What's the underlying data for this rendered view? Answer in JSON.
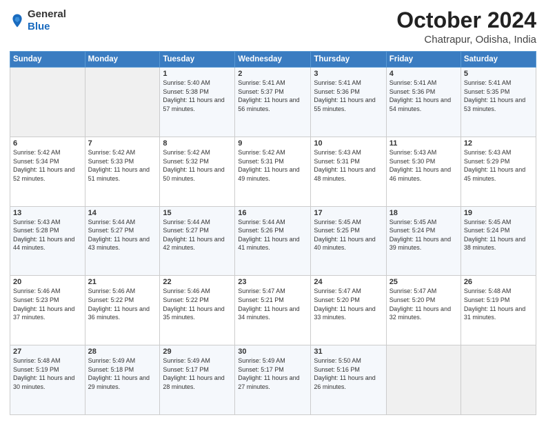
{
  "header": {
    "logo_general": "General",
    "logo_blue": "Blue",
    "month": "October 2024",
    "location": "Chatrapur, Odisha, India"
  },
  "days_of_week": [
    "Sunday",
    "Monday",
    "Tuesday",
    "Wednesday",
    "Thursday",
    "Friday",
    "Saturday"
  ],
  "weeks": [
    [
      {
        "day": "",
        "sunrise": "",
        "sunset": "",
        "daylight": ""
      },
      {
        "day": "",
        "sunrise": "",
        "sunset": "",
        "daylight": ""
      },
      {
        "day": "1",
        "sunrise": "Sunrise: 5:40 AM",
        "sunset": "Sunset: 5:38 PM",
        "daylight": "Daylight: 11 hours and 57 minutes."
      },
      {
        "day": "2",
        "sunrise": "Sunrise: 5:41 AM",
        "sunset": "Sunset: 5:37 PM",
        "daylight": "Daylight: 11 hours and 56 minutes."
      },
      {
        "day": "3",
        "sunrise": "Sunrise: 5:41 AM",
        "sunset": "Sunset: 5:36 PM",
        "daylight": "Daylight: 11 hours and 55 minutes."
      },
      {
        "day": "4",
        "sunrise": "Sunrise: 5:41 AM",
        "sunset": "Sunset: 5:36 PM",
        "daylight": "Daylight: 11 hours and 54 minutes."
      },
      {
        "day": "5",
        "sunrise": "Sunrise: 5:41 AM",
        "sunset": "Sunset: 5:35 PM",
        "daylight": "Daylight: 11 hours and 53 minutes."
      }
    ],
    [
      {
        "day": "6",
        "sunrise": "Sunrise: 5:42 AM",
        "sunset": "Sunset: 5:34 PM",
        "daylight": "Daylight: 11 hours and 52 minutes."
      },
      {
        "day": "7",
        "sunrise": "Sunrise: 5:42 AM",
        "sunset": "Sunset: 5:33 PM",
        "daylight": "Daylight: 11 hours and 51 minutes."
      },
      {
        "day": "8",
        "sunrise": "Sunrise: 5:42 AM",
        "sunset": "Sunset: 5:32 PM",
        "daylight": "Daylight: 11 hours and 50 minutes."
      },
      {
        "day": "9",
        "sunrise": "Sunrise: 5:42 AM",
        "sunset": "Sunset: 5:31 PM",
        "daylight": "Daylight: 11 hours and 49 minutes."
      },
      {
        "day": "10",
        "sunrise": "Sunrise: 5:43 AM",
        "sunset": "Sunset: 5:31 PM",
        "daylight": "Daylight: 11 hours and 48 minutes."
      },
      {
        "day": "11",
        "sunrise": "Sunrise: 5:43 AM",
        "sunset": "Sunset: 5:30 PM",
        "daylight": "Daylight: 11 hours and 46 minutes."
      },
      {
        "day": "12",
        "sunrise": "Sunrise: 5:43 AM",
        "sunset": "Sunset: 5:29 PM",
        "daylight": "Daylight: 11 hours and 45 minutes."
      }
    ],
    [
      {
        "day": "13",
        "sunrise": "Sunrise: 5:43 AM",
        "sunset": "Sunset: 5:28 PM",
        "daylight": "Daylight: 11 hours and 44 minutes."
      },
      {
        "day": "14",
        "sunrise": "Sunrise: 5:44 AM",
        "sunset": "Sunset: 5:27 PM",
        "daylight": "Daylight: 11 hours and 43 minutes."
      },
      {
        "day": "15",
        "sunrise": "Sunrise: 5:44 AM",
        "sunset": "Sunset: 5:27 PM",
        "daylight": "Daylight: 11 hours and 42 minutes."
      },
      {
        "day": "16",
        "sunrise": "Sunrise: 5:44 AM",
        "sunset": "Sunset: 5:26 PM",
        "daylight": "Daylight: 11 hours and 41 minutes."
      },
      {
        "day": "17",
        "sunrise": "Sunrise: 5:45 AM",
        "sunset": "Sunset: 5:25 PM",
        "daylight": "Daylight: 11 hours and 40 minutes."
      },
      {
        "day": "18",
        "sunrise": "Sunrise: 5:45 AM",
        "sunset": "Sunset: 5:24 PM",
        "daylight": "Daylight: 11 hours and 39 minutes."
      },
      {
        "day": "19",
        "sunrise": "Sunrise: 5:45 AM",
        "sunset": "Sunset: 5:24 PM",
        "daylight": "Daylight: 11 hours and 38 minutes."
      }
    ],
    [
      {
        "day": "20",
        "sunrise": "Sunrise: 5:46 AM",
        "sunset": "Sunset: 5:23 PM",
        "daylight": "Daylight: 11 hours and 37 minutes."
      },
      {
        "day": "21",
        "sunrise": "Sunrise: 5:46 AM",
        "sunset": "Sunset: 5:22 PM",
        "daylight": "Daylight: 11 hours and 36 minutes."
      },
      {
        "day": "22",
        "sunrise": "Sunrise: 5:46 AM",
        "sunset": "Sunset: 5:22 PM",
        "daylight": "Daylight: 11 hours and 35 minutes."
      },
      {
        "day": "23",
        "sunrise": "Sunrise: 5:47 AM",
        "sunset": "Sunset: 5:21 PM",
        "daylight": "Daylight: 11 hours and 34 minutes."
      },
      {
        "day": "24",
        "sunrise": "Sunrise: 5:47 AM",
        "sunset": "Sunset: 5:20 PM",
        "daylight": "Daylight: 11 hours and 33 minutes."
      },
      {
        "day": "25",
        "sunrise": "Sunrise: 5:47 AM",
        "sunset": "Sunset: 5:20 PM",
        "daylight": "Daylight: 11 hours and 32 minutes."
      },
      {
        "day": "26",
        "sunrise": "Sunrise: 5:48 AM",
        "sunset": "Sunset: 5:19 PM",
        "daylight": "Daylight: 11 hours and 31 minutes."
      }
    ],
    [
      {
        "day": "27",
        "sunrise": "Sunrise: 5:48 AM",
        "sunset": "Sunset: 5:19 PM",
        "daylight": "Daylight: 11 hours and 30 minutes."
      },
      {
        "day": "28",
        "sunrise": "Sunrise: 5:49 AM",
        "sunset": "Sunset: 5:18 PM",
        "daylight": "Daylight: 11 hours and 29 minutes."
      },
      {
        "day": "29",
        "sunrise": "Sunrise: 5:49 AM",
        "sunset": "Sunset: 5:17 PM",
        "daylight": "Daylight: 11 hours and 28 minutes."
      },
      {
        "day": "30",
        "sunrise": "Sunrise: 5:49 AM",
        "sunset": "Sunset: 5:17 PM",
        "daylight": "Daylight: 11 hours and 27 minutes."
      },
      {
        "day": "31",
        "sunrise": "Sunrise: 5:50 AM",
        "sunset": "Sunset: 5:16 PM",
        "daylight": "Daylight: 11 hours and 26 minutes."
      },
      {
        "day": "",
        "sunrise": "",
        "sunset": "",
        "daylight": ""
      },
      {
        "day": "",
        "sunrise": "",
        "sunset": "",
        "daylight": ""
      }
    ]
  ]
}
